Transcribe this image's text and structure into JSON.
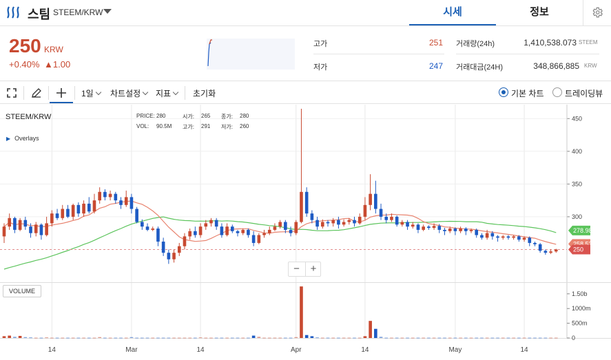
{
  "header": {
    "coin_name": "스팀",
    "pair": "STEEM/KRW",
    "tabs": [
      {
        "label": "시세",
        "active": true
      },
      {
        "label": "정보",
        "active": false
      }
    ]
  },
  "ticker": {
    "price": "250",
    "unit": "KRW",
    "change_pct": "+0.40%",
    "change_val": "▲1.00",
    "high_label": "고가",
    "high_value": "251",
    "low_label": "저가",
    "low_value": "247",
    "volume_label": "거래량(24h)",
    "volume_value": "1,410,538.073",
    "volume_unit": "STEEM",
    "amount_label": "거래대금(24H)",
    "amount_value": "348,866,885",
    "amount_unit": "KRW"
  },
  "toolbar": {
    "interval": "1일",
    "chart_settings": "차트설정",
    "indicators": "지표",
    "reset": "초기화",
    "basic_chart": "기본 차트",
    "tradingview": "트레이딩뷰"
  },
  "chart_info": {
    "symbol": "STEEM/KRW",
    "overlays": "Overlays",
    "price_label": "PRICE:",
    "price_val": "280",
    "open_label": "시가:",
    "open_val": "265",
    "close_label": "종가:",
    "close_val": "280",
    "vol_label": "VOL:",
    "vol_val": "90.5M",
    "high_label": "고가:",
    "high_val": "291",
    "low_label": "저가:",
    "low_val": "260",
    "volume_panel": "VOLUME",
    "zoom_out": "−",
    "zoom_in": "+"
  },
  "colors": {
    "up": "#c84a31",
    "down": "#1e5bc4",
    "ma_long": "#5cc45c",
    "ma_short": "#e8836f",
    "accent": "#1a5fb4"
  },
  "chart_data": {
    "type": "candlestick",
    "y_ticks": [
      300,
      350,
      400,
      450
    ],
    "ylim": [
      200,
      465
    ],
    "vol_ticks": [
      "0",
      "500m",
      "1000m",
      "1.50b"
    ],
    "vol_lim": [
      0,
      1800
    ],
    "x_ticks": [
      {
        "label": "14",
        "index": 9
      },
      {
        "label": "Mar",
        "index": 24
      },
      {
        "label": "14",
        "index": 37
      },
      {
        "label": "Apr",
        "index": 55
      },
      {
        "label": "14",
        "index": 68
      },
      {
        "label": "May",
        "index": 85
      },
      {
        "label": "14",
        "index": 98
      }
    ],
    "candles": [
      [
        270,
        285,
        260,
        290
      ],
      [
        285,
        298,
        280,
        305
      ],
      [
        298,
        280,
        275,
        300
      ],
      [
        280,
        295,
        278,
        298
      ],
      [
        295,
        285,
        280,
        300
      ],
      [
        285,
        275,
        268,
        290
      ],
      [
        275,
        288,
        270,
        292
      ],
      [
        288,
        272,
        265,
        290
      ],
      [
        272,
        290,
        270,
        300
      ],
      [
        290,
        305,
        285,
        310
      ],
      [
        305,
        298,
        295,
        312
      ],
      [
        298,
        312,
        295,
        318
      ],
      [
        312,
        300,
        298,
        318
      ],
      [
        300,
        318,
        295,
        320
      ],
      [
        318,
        305,
        300,
        322
      ],
      [
        305,
        320,
        300,
        325
      ],
      [
        320,
        308,
        305,
        330
      ],
      [
        308,
        325,
        305,
        335
      ],
      [
        325,
        338,
        320,
        345
      ],
      [
        338,
        330,
        325,
        342
      ],
      [
        330,
        335,
        325,
        340
      ],
      [
        335,
        325,
        320,
        338
      ],
      [
        325,
        318,
        312,
        330
      ],
      [
        318,
        330,
        315,
        340
      ],
      [
        330,
        312,
        305,
        335
      ],
      [
        312,
        292,
        290,
        315
      ],
      [
        292,
        285,
        280,
        296
      ],
      [
        285,
        280,
        278,
        290
      ],
      [
        280,
        282,
        278,
        285
      ],
      [
        282,
        262,
        255,
        285
      ],
      [
        262,
        245,
        240,
        268
      ],
      [
        245,
        235,
        228,
        250
      ],
      [
        235,
        245,
        230,
        250
      ],
      [
        245,
        255,
        240,
        260
      ],
      [
        255,
        270,
        250,
        275
      ],
      [
        270,
        278,
        265,
        282
      ],
      [
        278,
        272,
        268,
        285
      ],
      [
        272,
        285,
        268,
        290
      ],
      [
        285,
        290,
        280,
        295
      ],
      [
        290,
        295,
        285,
        298
      ],
      [
        295,
        285,
        280,
        298
      ],
      [
        285,
        272,
        268,
        290
      ],
      [
        272,
        285,
        270,
        290
      ],
      [
        285,
        278,
        275,
        288
      ],
      [
        278,
        275,
        270,
        280
      ],
      [
        275,
        280,
        272,
        282
      ],
      [
        280,
        272,
        268,
        282
      ],
      [
        272,
        260,
        255,
        278
      ],
      [
        260,
        272,
        258,
        275
      ],
      [
        272,
        275,
        268,
        280
      ],
      [
        275,
        280,
        272,
        285
      ],
      [
        280,
        285,
        278,
        290
      ],
      [
        285,
        292,
        282,
        295
      ],
      [
        292,
        280,
        275,
        295
      ],
      [
        280,
        275,
        270,
        285
      ],
      [
        275,
        292,
        272,
        295
      ],
      [
        292,
        338,
        290,
        465
      ],
      [
        338,
        305,
        300,
        345
      ],
      [
        305,
        295,
        290,
        310
      ],
      [
        295,
        285,
        280,
        300
      ],
      [
        285,
        292,
        282,
        296
      ],
      [
        292,
        290,
        285,
        295
      ],
      [
        290,
        295,
        285,
        298
      ],
      [
        295,
        288,
        282,
        300
      ],
      [
        288,
        292,
        285,
        296
      ],
      [
        292,
        295,
        288,
        298
      ],
      [
        295,
        290,
        285,
        300
      ],
      [
        290,
        300,
        288,
        305
      ],
      [
        300,
        318,
        295,
        330
      ],
      [
        318,
        335,
        310,
        365
      ],
      [
        335,
        312,
        305,
        355
      ],
      [
        312,
        300,
        295,
        320
      ],
      [
        300,
        295,
        290,
        305
      ],
      [
        295,
        300,
        292,
        305
      ],
      [
        300,
        288,
        285,
        302
      ],
      [
        288,
        292,
        285,
        295
      ],
      [
        292,
        285,
        280,
        295
      ],
      [
        285,
        288,
        282,
        292
      ],
      [
        288,
        280,
        275,
        290
      ],
      [
        280,
        285,
        278,
        288
      ],
      [
        285,
        283,
        280,
        287
      ],
      [
        283,
        286,
        280,
        290
      ],
      [
        286,
        280,
        275,
        289
      ],
      [
        280,
        278,
        272,
        283
      ],
      [
        278,
        282,
        275,
        285
      ],
      [
        282,
        278,
        272,
        284
      ],
      [
        278,
        282,
        275,
        285
      ],
      [
        282,
        278,
        272,
        284
      ],
      [
        278,
        280,
        275,
        282
      ],
      [
        280,
        272,
        268,
        282
      ],
      [
        272,
        268,
        265,
        275
      ],
      [
        268,
        275,
        265,
        280
      ],
      [
        275,
        270,
        265,
        278
      ],
      [
        270,
        268,
        262,
        272
      ],
      [
        268,
        270,
        265,
        272
      ],
      [
        270,
        268,
        265,
        272
      ],
      [
        268,
        270,
        265,
        272
      ],
      [
        270,
        265,
        262,
        272
      ],
      [
        265,
        268,
        262,
        270
      ],
      [
        268,
        260,
        255,
        270
      ],
      [
        260,
        258,
        255,
        262
      ],
      [
        258,
        248,
        245,
        260
      ],
      [
        248,
        245,
        242,
        250
      ],
      [
        245,
        247,
        243,
        250
      ],
      [
        247,
        250,
        245,
        251
      ]
    ],
    "volumes": [
      60,
      80,
      40,
      70,
      30,
      20,
      10,
      10,
      20,
      10,
      10,
      10,
      10,
      10,
      10,
      10,
      10,
      10,
      30,
      10,
      10,
      10,
      10,
      10,
      30,
      10,
      10,
      10,
      10,
      10,
      10,
      10,
      10,
      10,
      10,
      10,
      10,
      20,
      10,
      10,
      10,
      10,
      10,
      10,
      10,
      10,
      10,
      80,
      40,
      10,
      10,
      10,
      10,
      10,
      10,
      30,
      1750,
      100,
      60,
      20,
      10,
      10,
      10,
      10,
      10,
      10,
      10,
      10,
      60,
      580,
      310,
      40,
      10,
      10,
      10,
      10,
      10,
      10,
      10,
      10,
      10,
      10,
      10,
      10,
      10,
      10,
      10,
      10,
      10,
      10,
      10,
      10,
      10,
      10,
      10,
      10,
      10,
      10,
      10,
      10,
      10,
      10,
      10,
      10,
      10
    ],
    "ma_long_last": "278.98",
    "ma_short_last": "258.533",
    "last_price": "250",
    "last_price_value": 250,
    "ma_long_last_value": 278.98,
    "ma_short_last_value": 258.533
  }
}
